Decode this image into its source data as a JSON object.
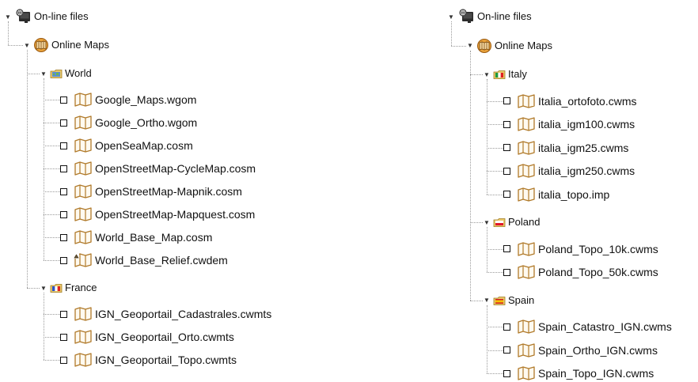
{
  "left": {
    "root": "On-line files",
    "online_maps": "Online Maps",
    "groups": [
      {
        "label": "World",
        "flag": "world-map-folder-icon",
        "files": [
          {
            "name": "Google_Maps.wgom",
            "icon": "map-file-icon"
          },
          {
            "name": "Google_Ortho.wgom",
            "icon": "map-file-icon"
          },
          {
            "name": "OpenSeaMap.cosm",
            "icon": "map-file-icon"
          },
          {
            "name": "OpenStreetMap-CycleMap.cosm",
            "icon": "map-file-icon"
          },
          {
            "name": "OpenStreetMap-Mapnik.cosm",
            "icon": "map-file-icon"
          },
          {
            "name": "OpenStreetMap-Mapquest.cosm",
            "icon": "map-file-icon"
          },
          {
            "name": "World_Base_Map.cosm",
            "icon": "map-file-icon"
          },
          {
            "name": "World_Base_Relief.cwdem",
            "icon": "relief-map-file-icon"
          }
        ]
      },
      {
        "label": "France",
        "flag": "france-flag-folder-icon",
        "files": [
          {
            "name": "IGN_Geoportail_Cadastrales.cwmts",
            "icon": "map-file-icon"
          },
          {
            "name": "IGN_Geoportail_Orto.cwmts",
            "icon": "map-file-icon"
          },
          {
            "name": "IGN_Geoportail_Topo.cwmts",
            "icon": "map-file-icon"
          }
        ]
      }
    ]
  },
  "right": {
    "root": "On-line files",
    "online_maps": "Online Maps",
    "groups": [
      {
        "label": "Italy",
        "flag": "italy-flag-folder-icon",
        "files": [
          {
            "name": "Italia_ortofoto.cwms",
            "icon": "map-file-icon"
          },
          {
            "name": "italia_igm100.cwms",
            "icon": "map-file-icon"
          },
          {
            "name": "italia_igm25.cwms",
            "icon": "map-file-icon"
          },
          {
            "name": "italia_igm250.cwms",
            "icon": "map-file-icon"
          },
          {
            "name": "italia_topo.imp",
            "icon": "map-file-icon"
          }
        ]
      },
      {
        "label": "Poland",
        "flag": "poland-flag-folder-icon",
        "files": [
          {
            "name": "Poland_Topo_10k.cwms",
            "icon": "map-file-icon"
          },
          {
            "name": "Poland_Topo_50k.cwms",
            "icon": "map-file-icon"
          }
        ]
      },
      {
        "label": "Spain",
        "flag": "spain-flag-folder-icon",
        "files": [
          {
            "name": "Spain_Catastro_IGN.cwms",
            "icon": "map-file-icon"
          },
          {
            "name": "Spain_Ortho_IGN.cwms",
            "icon": "map-file-icon"
          },
          {
            "name": "Spain_Topo_IGN.cwms",
            "icon": "map-file-icon"
          }
        ]
      }
    ]
  }
}
